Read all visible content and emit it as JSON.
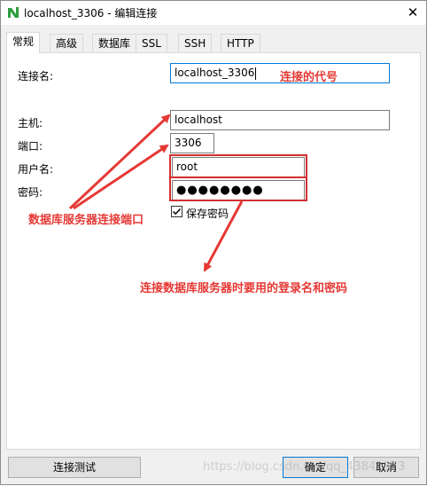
{
  "window": {
    "title": "localhost_3306 - 编辑连接",
    "close_glyph": "✕"
  },
  "tabs": [
    {
      "label": "常规",
      "active": true
    },
    {
      "label": "高级",
      "active": false
    },
    {
      "label": "数据库",
      "active": false
    },
    {
      "label": "SSL",
      "active": false
    },
    {
      "label": "SSH",
      "active": false
    },
    {
      "label": "HTTP",
      "active": false
    }
  ],
  "form": {
    "connection_name_label": "连接名:",
    "connection_name_value": "localhost_3306",
    "host_label": "主机:",
    "host_value": "localhost",
    "port_label": "端口:",
    "port_value": "3306",
    "username_label": "用户名:",
    "username_value": "root",
    "password_label": "密码:",
    "password_value": "●●●●●●●●",
    "save_password_label": "保存密码",
    "save_password_checked": true
  },
  "annotations": {
    "connection_name_note": "连接的代号",
    "port_note": "数据库服务器连接端口",
    "login_note": "连接数据库服务器时要用的登录名和密码",
    "color": "#e53935"
  },
  "buttons": {
    "test_connection": "连接测试",
    "ok": "确定",
    "cancel": "取消"
  },
  "watermark": "https://blog.csdn.net/qq_43841973",
  "colors": {
    "focus_border": "#0078d7",
    "annotation_red": "#e53935",
    "app_icon_green": "#2e9e3f"
  },
  "icons": {
    "app": "navicat-icon",
    "close": "close-icon",
    "check": "checkmark-icon"
  }
}
